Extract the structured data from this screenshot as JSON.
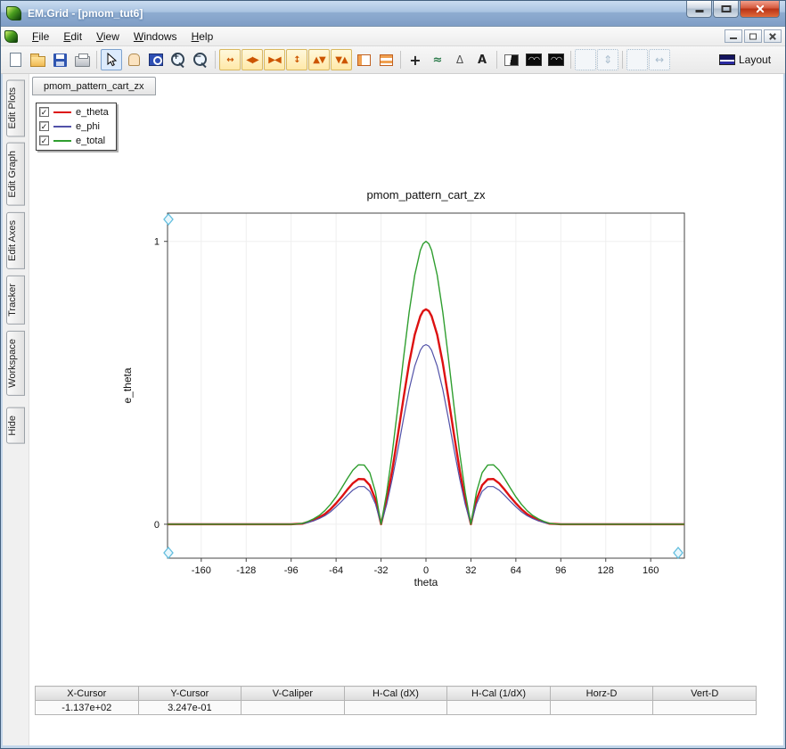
{
  "window": {
    "title": "EM.Grid - [pmom_tut6]"
  },
  "menu": {
    "items": [
      "File",
      "Edit",
      "View",
      "Windows",
      "Help"
    ]
  },
  "icons": {
    "check": "✓"
  },
  "toolbar": {
    "buttons": [
      {
        "name": "new-file",
        "glyph": ""
      },
      {
        "name": "open-file",
        "glyph": ""
      },
      {
        "name": "save-file",
        "glyph": ""
      },
      {
        "name": "print",
        "glyph": ""
      },
      {
        "name": "select-pointer",
        "glyph": ""
      },
      {
        "name": "pan-hand",
        "glyph": ""
      },
      {
        "name": "zoom-window",
        "glyph": ""
      },
      {
        "name": "zoom-in",
        "glyph": "+"
      },
      {
        "name": "zoom-out",
        "glyph": "−"
      },
      {
        "name": "expand-x-axis",
        "glyph": "↔"
      },
      {
        "name": "scroll-x-axis",
        "glyph": "◀▶"
      },
      {
        "name": "shrink-x-axis",
        "glyph": "▶◀"
      },
      {
        "name": "expand-y-axis",
        "glyph": "↕"
      },
      {
        "name": "scroll-y-axis",
        "glyph": "▲▼"
      },
      {
        "name": "shrink-y-axis",
        "glyph": "▼▲"
      },
      {
        "name": "table-columns",
        "glyph": ""
      },
      {
        "name": "table-rows",
        "glyph": ""
      },
      {
        "name": "add-marker",
        "glyph": "+"
      },
      {
        "name": "curve-tracker",
        "glyph": "≈"
      },
      {
        "name": "slope-tool",
        "glyph": "Δ"
      },
      {
        "name": "text-annotation",
        "glyph": "A"
      },
      {
        "name": "invert-plot",
        "glyph": ""
      },
      {
        "name": "waveform-a",
        "glyph": "◠◠"
      },
      {
        "name": "waveform-b",
        "glyph": "◠◠"
      },
      {
        "name": "fit-box",
        "glyph": ""
      },
      {
        "name": "fit-vertical",
        "glyph": "⇕"
      },
      {
        "name": "fit-box-2",
        "glyph": ""
      },
      {
        "name": "fit-horizontal",
        "glyph": "↔"
      },
      {
        "name": "layout",
        "glyph": "",
        "label": "Layout"
      }
    ]
  },
  "sidebar": {
    "tabs": [
      "Edit Plots",
      "Edit Graph",
      "Edit Axes",
      "Tracker",
      "Workspace",
      "Hide"
    ]
  },
  "doc_tab": {
    "label": "pmom_pattern_cart_zx"
  },
  "legend": {
    "items": [
      {
        "label": "e_theta",
        "color": "#dd1111",
        "checked": true
      },
      {
        "label": "e_phi",
        "color": "#5151a8",
        "checked": true
      },
      {
        "label": "e_total",
        "color": "#2f9e2f",
        "checked": true
      }
    ]
  },
  "chart_data": {
    "type": "line",
    "title": "pmom_pattern_cart_zx",
    "xlabel": "theta",
    "ylabel": "e_theta",
    "xlim": [
      -184,
      184
    ],
    "ylim": [
      -0.12,
      1.1
    ],
    "x_ticks": [
      -160,
      -128,
      -96,
      -64,
      -32,
      0,
      32,
      64,
      96,
      128,
      160
    ],
    "y_ticks": [
      0,
      1
    ],
    "grid": "faint",
    "legend_position": "top-left-overlay",
    "x": [
      -184,
      -180,
      -150,
      -120,
      -100,
      -96,
      -92,
      -88,
      -84,
      -80,
      -76,
      -72,
      -68,
      -64,
      -60,
      -56,
      -52,
      -48,
      -44,
      -40,
      -36,
      -32,
      -28,
      -24,
      -20,
      -16,
      -12,
      -8,
      -4,
      -2,
      0,
      2,
      4,
      8,
      12,
      16,
      20,
      24,
      28,
      32,
      36,
      40,
      44,
      48,
      52,
      56,
      60,
      64,
      68,
      72,
      76,
      80,
      84,
      88,
      92,
      96,
      100,
      120,
      150,
      180,
      184
    ],
    "series": [
      {
        "name": "e_theta",
        "color": "#dd1111",
        "width": 2.4,
        "values": [
          0,
          0,
          0,
          0,
          0,
          0,
          0.001,
          0.002,
          0.008,
          0.014,
          0.024,
          0.036,
          0.053,
          0.074,
          0.097,
          0.122,
          0.145,
          0.16,
          0.159,
          0.138,
          0.087,
          0,
          0.084,
          0.192,
          0.316,
          0.446,
          0.569,
          0.67,
          0.736,
          0.754,
          0.76,
          0.754,
          0.736,
          0.67,
          0.569,
          0.446,
          0.316,
          0.192,
          0.084,
          0,
          0.087,
          0.138,
          0.159,
          0.16,
          0.145,
          0.122,
          0.097,
          0.074,
          0.053,
          0.036,
          0.024,
          0.014,
          0.008,
          0.002,
          0.001,
          0,
          0,
          0,
          0,
          0,
          0
        ]
      },
      {
        "name": "e_phi",
        "color": "#5151a8",
        "width": 1.2,
        "values": [
          0,
          0,
          0,
          0,
          0,
          0,
          0.001,
          0.002,
          0.006,
          0.012,
          0.02,
          0.03,
          0.044,
          0.062,
          0.081,
          0.102,
          0.121,
          0.133,
          0.133,
          0.116,
          0.072,
          0,
          0.07,
          0.161,
          0.264,
          0.373,
          0.476,
          0.559,
          0.615,
          0.63,
          0.635,
          0.63,
          0.615,
          0.559,
          0.476,
          0.373,
          0.264,
          0.161,
          0.07,
          0,
          0.072,
          0.116,
          0.133,
          0.133,
          0.121,
          0.102,
          0.081,
          0.062,
          0.044,
          0.03,
          0.02,
          0.012,
          0.006,
          0.002,
          0.001,
          0,
          0,
          0,
          0,
          0,
          0
        ]
      },
      {
        "name": "e_total",
        "color": "#2f9e2f",
        "width": 1.4,
        "values": [
          0,
          0,
          0,
          0,
          0,
          0,
          0.001,
          0.003,
          0.01,
          0.019,
          0.031,
          0.048,
          0.07,
          0.097,
          0.128,
          0.161,
          0.191,
          0.21,
          0.209,
          0.182,
          0.114,
          0,
          0.111,
          0.253,
          0.416,
          0.587,
          0.749,
          0.881,
          0.969,
          0.992,
          1.0,
          0.992,
          0.969,
          0.881,
          0.749,
          0.587,
          0.416,
          0.253,
          0.111,
          0,
          0.114,
          0.182,
          0.209,
          0.21,
          0.191,
          0.161,
          0.128,
          0.097,
          0.07,
          0.048,
          0.031,
          0.019,
          0.01,
          0.003,
          0.001,
          0,
          0,
          0,
          0,
          0,
          0
        ]
      }
    ]
  },
  "status_table": {
    "headers": [
      "X-Cursor",
      "Y-Cursor",
      "V-Caliper",
      "H-Cal (dX)",
      "H-Cal (1/dX)",
      "Horz-D",
      "Vert-D"
    ],
    "values": [
      "-1.137e+02",
      "3.247e-01",
      "",
      "",
      "",
      "",
      ""
    ]
  }
}
